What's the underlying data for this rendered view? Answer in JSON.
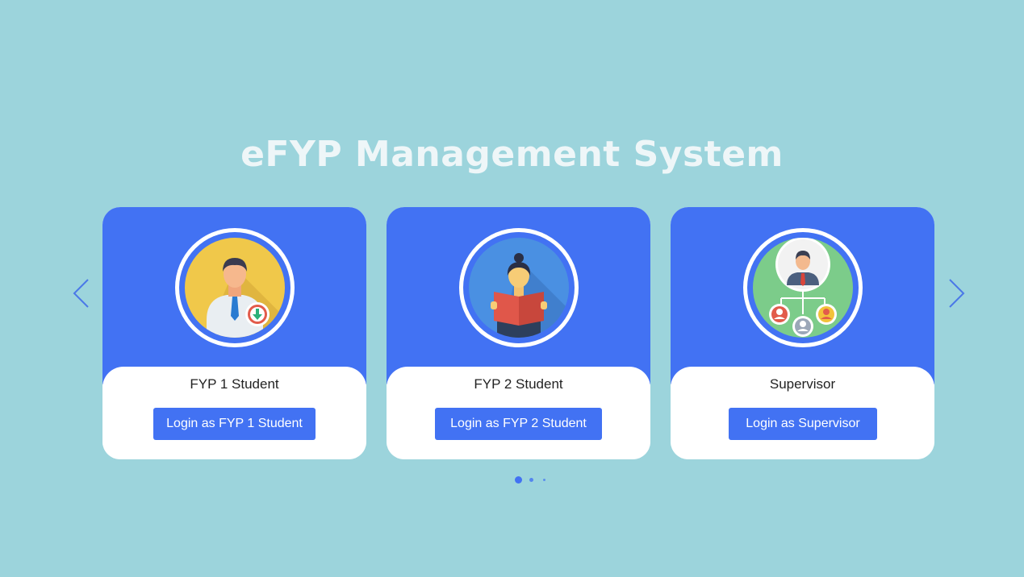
{
  "page": {
    "title": "eFYP Management System"
  },
  "cards": [
    {
      "label": "FYP 1 Student",
      "button": "Login as FYP 1 Student",
      "icon": "student-download-icon",
      "circle_color": "#f0c84a"
    },
    {
      "label": "FYP 2 Student",
      "button": "Login as FYP 2 Student",
      "icon": "student-reading-icon",
      "circle_color": "#4a90e2"
    },
    {
      "label": "Supervisor",
      "button": "Login as Supervisor",
      "icon": "supervisor-network-icon",
      "circle_color": "#7ccc8a"
    }
  ],
  "carousel": {
    "prev_icon": "chevron-left-icon",
    "next_icon": "chevron-right-icon",
    "dots_count": 3,
    "active_index": 0
  },
  "colors": {
    "background": "#9cd4dc",
    "accent": "#4272f3",
    "title": "#eef6f8",
    "card": "#ffffff"
  }
}
